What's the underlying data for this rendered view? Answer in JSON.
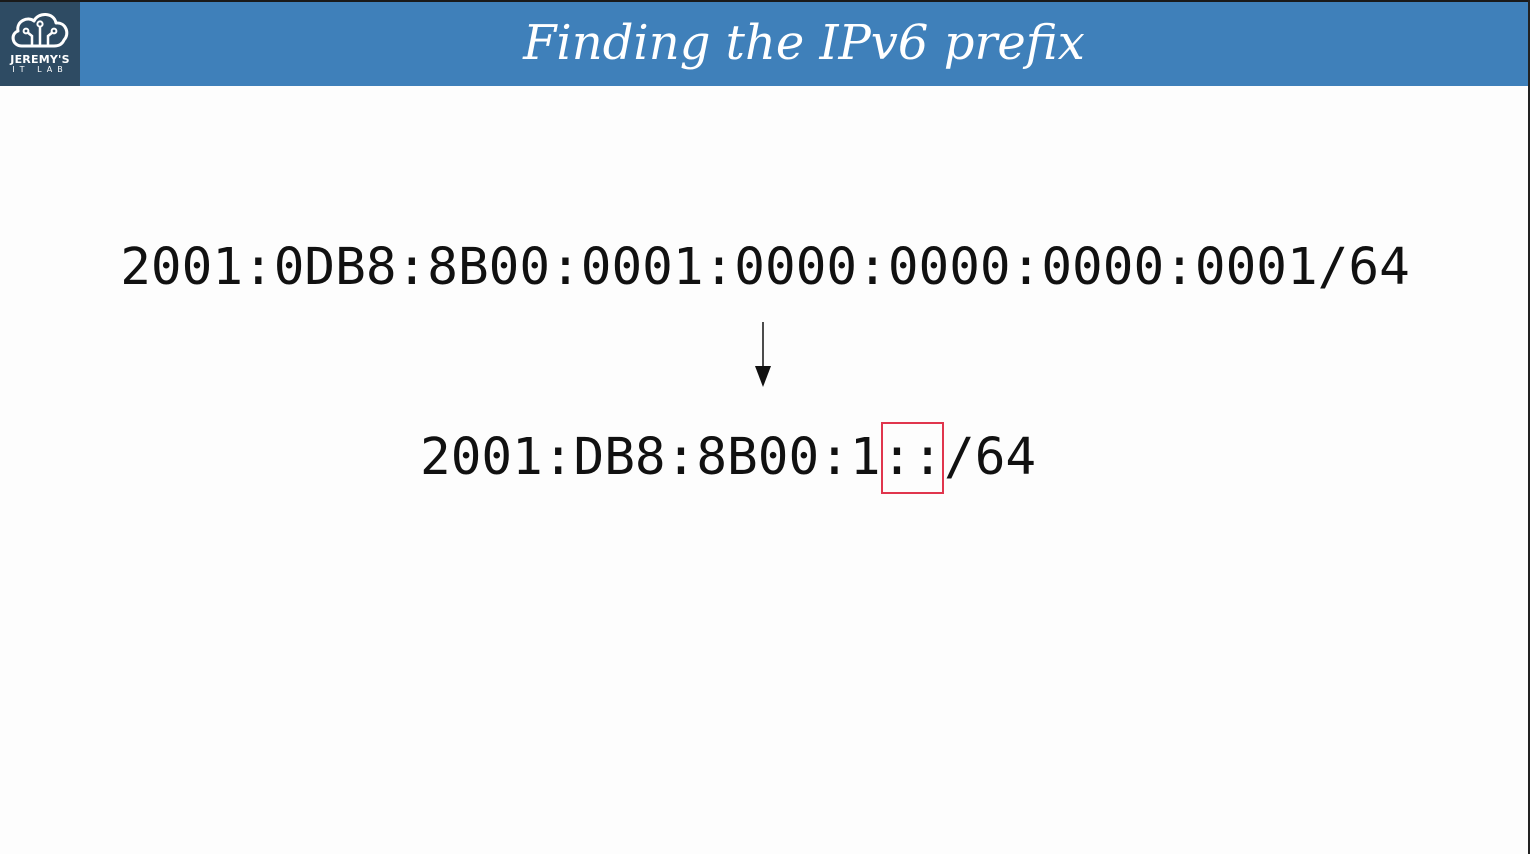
{
  "header": {
    "title": "Finding the IPv6 prefix",
    "background_color": "#3f80ba"
  },
  "logo": {
    "line1": "JEREMY'S",
    "line2": "IT LAB",
    "icon": "cloud-circuit-icon"
  },
  "content": {
    "full_address": "2001:0DB8:8B00:0001:0000:0000:0000:0001/64",
    "compressed_address_before": "2001:DB8:8B00:1",
    "compressed_address_highlight": "::",
    "compressed_address_after": "/64",
    "arrow_icon": "arrow-down-icon",
    "highlight_color": "#e0354d"
  }
}
